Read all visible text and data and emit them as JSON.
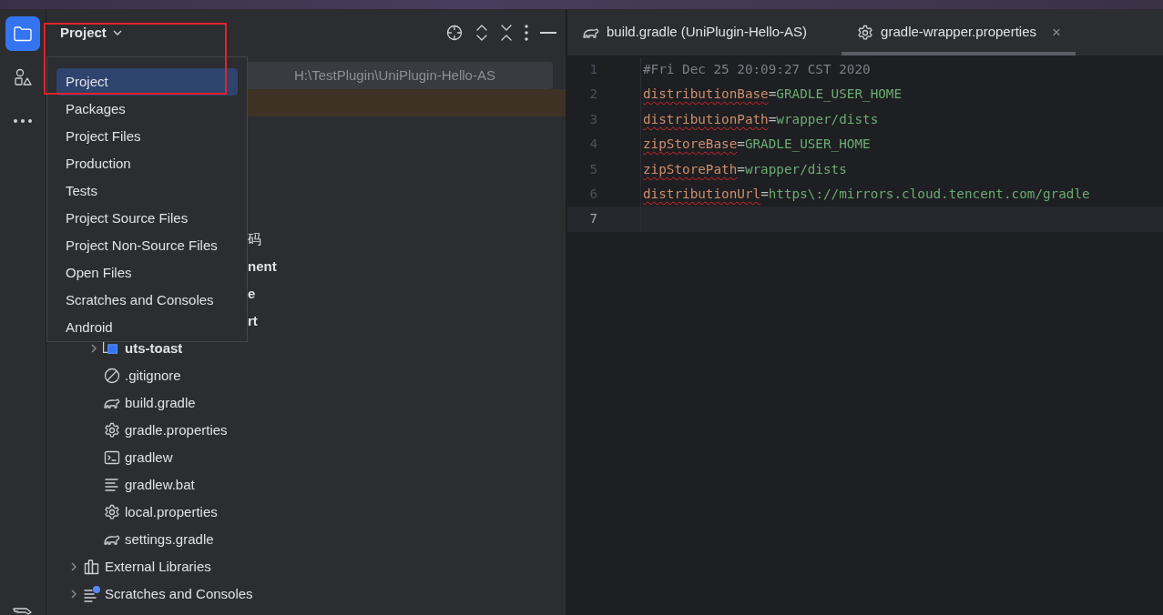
{
  "tool_strip": {
    "items": [
      {
        "kind": "folder",
        "selected": true
      },
      {
        "kind": "structure",
        "selected": false
      },
      {
        "kind": "more",
        "selected": false
      },
      {
        "kind": "hammer"
      }
    ]
  },
  "project_panel": {
    "title": "Project",
    "path_hint": "H:\\TestPlugin\\UniPlugin-Hello-AS",
    "view_menu": {
      "items": [
        {
          "label": "Project",
          "selected": true
        },
        {
          "label": "Packages",
          "selected": false
        },
        {
          "label": "Project Files",
          "selected": false
        },
        {
          "label": "Production",
          "selected": false
        },
        {
          "label": "Tests",
          "selected": false
        },
        {
          "label": "Project Source Files",
          "selected": false
        },
        {
          "label": "Project Non-Source Files",
          "selected": false
        },
        {
          "label": "Open Files",
          "selected": false
        },
        {
          "label": "Scratches and Consoles",
          "selected": false
        },
        {
          "label": "Android",
          "selected": false
        }
      ]
    },
    "tree": [
      {
        "selected": true,
        "expanded": true,
        "children": [
          {
            "label": "码",
            "bold": false
          },
          {
            "label": "nent",
            "bold": true
          },
          {
            "label": "e",
            "bold": true
          },
          {
            "label": "rt",
            "bold": true
          },
          {
            "label": "uts-toast",
            "kind": "module",
            "bold": true,
            "expanded": false
          },
          {
            "label": ".gitignore",
            "kind": "ignore",
            "bold": false
          },
          {
            "label": "build.gradle",
            "kind": "gradle",
            "bold": false
          },
          {
            "label": "gradle.properties",
            "kind": "settings",
            "bold": false
          },
          {
            "label": "gradlew",
            "kind": "terminal",
            "bold": false
          },
          {
            "label": "gradlew.bat",
            "kind": "text",
            "bold": false
          },
          {
            "label": "local.properties",
            "kind": "settings",
            "bold": false
          },
          {
            "label": "settings.gradle",
            "kind": "gradle",
            "bold": false
          }
        ]
      },
      {
        "label": "External Libraries",
        "kind": "library",
        "bold": false,
        "expanded": false
      },
      {
        "label": "Scratches and Consoles",
        "kind": "scratches",
        "bold": false,
        "expanded": false
      }
    ]
  },
  "editor": {
    "tabs": [
      {
        "label": "build.gradle (UniPlugin-Hello-AS)",
        "kind": "gradle",
        "selected": false
      },
      {
        "label": "gradle-wrapper.properties",
        "kind": "settings",
        "selected": true,
        "close": "×"
      }
    ],
    "lines": [
      {
        "number": "1",
        "kind": "comment",
        "text": "#Fri Dec 25 20:09:27 CST 2020",
        "current": false
      },
      {
        "number": "2",
        "kind": "property",
        "key": "distributionBase",
        "sep": "=",
        "value": "GRADLE_USER_HOME",
        "warning": true,
        "current": false
      },
      {
        "number": "3",
        "kind": "property",
        "key": "distributionPath",
        "sep": "=",
        "value": "wrapper/dists",
        "warning": true,
        "current": false
      },
      {
        "number": "4",
        "kind": "property",
        "key": "zipStoreBase",
        "sep": "=",
        "value": "GRADLE_USER_HOME",
        "warning": true,
        "current": false
      },
      {
        "number": "5",
        "kind": "property",
        "key": "zipStorePath",
        "sep": "=",
        "value": "wrapper/dists",
        "warning": true,
        "current": false
      },
      {
        "number": "6",
        "kind": "property",
        "key": "distributionUrl",
        "sep": "=",
        "value": "https\\://mirrors.cloud.tencent.com/gradle",
        "warning": true,
        "current": false
      },
      {
        "number": "7",
        "kind": "blank",
        "current": true
      }
    ]
  }
}
